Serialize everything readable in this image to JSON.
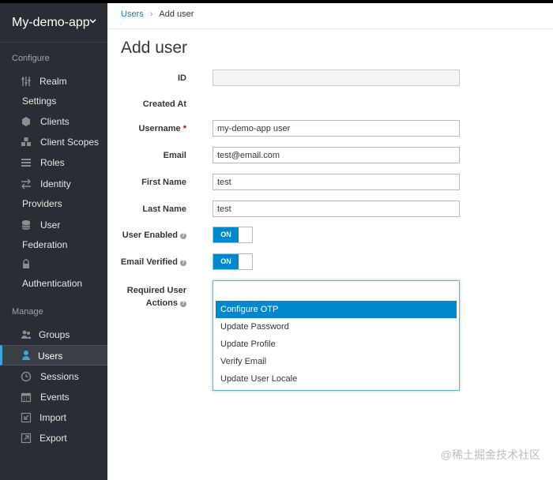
{
  "sidebar": {
    "realm_name": "My-demo-app",
    "configure_heading": "Configure",
    "configure_items": [
      {
        "label_1": "Realm",
        "label_2": "Settings",
        "icon": "sliders-icon"
      },
      {
        "label_1": "Clients",
        "icon": "cube-icon"
      },
      {
        "label_1": "Client Scopes",
        "icon": "cubes-icon"
      },
      {
        "label_1": "Roles",
        "icon": "list-icon"
      },
      {
        "label_1": "Identity",
        "label_2": "Providers",
        "icon": "exchange-icon"
      },
      {
        "label_1": "User",
        "label_2": "Federation",
        "icon": "database-icon"
      },
      {
        "label_2": "Authentication",
        "icon": "lock-icon"
      }
    ],
    "manage_heading": "Manage",
    "manage_items": [
      {
        "label": "Groups",
        "icon": "users-icon"
      },
      {
        "label": "Users",
        "icon": "user-icon",
        "active": true
      },
      {
        "label": "Sessions",
        "icon": "clock-icon"
      },
      {
        "label": "Events",
        "icon": "calendar-icon"
      },
      {
        "label": "Import",
        "icon": "import-icon"
      },
      {
        "label": "Export",
        "icon": "export-icon"
      }
    ]
  },
  "breadcrumb": {
    "parent": "Users",
    "current": "Add user"
  },
  "page_title": "Add user",
  "form": {
    "id_label": "ID",
    "id_value": "",
    "created_at_label": "Created At",
    "username_label": "Username",
    "username_required_mark": "*",
    "username_value": "my-demo-app user",
    "email_label": "Email",
    "email_value": "test@email.com",
    "first_name_label": "First Name",
    "first_name_value": "test",
    "last_name_label": "Last Name",
    "last_name_value": "test",
    "user_enabled_label": "User Enabled",
    "user_enabled_state": "ON",
    "email_verified_label": "Email Verified",
    "email_verified_state": "ON",
    "required_actions_label_1": "Required User",
    "required_actions_label_2": "Actions",
    "required_actions_options": [
      "Configure OTP",
      "Update Password",
      "Update Profile",
      "Verify Email",
      "Update User Locale"
    ],
    "required_actions_highlighted": "Configure OTP"
  },
  "colors": {
    "sidebar_bg": "#292e34",
    "accent": "#0088ce",
    "active_border": "#39a5dc"
  },
  "watermark": "@稀土掘金技术社区"
}
